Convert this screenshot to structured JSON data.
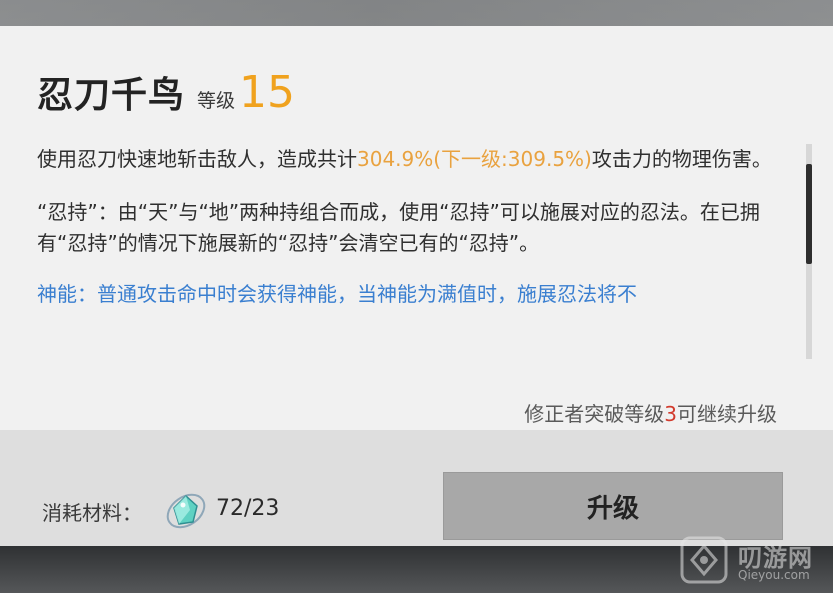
{
  "skill": {
    "name": "忍刀千鸟",
    "level_label": "等级",
    "level_value": "15"
  },
  "description": {
    "p1_prefix": "使用忍刀快速地斩击敌人，造成共计",
    "p1_highlight": "304.9%(下一级:309.5%)",
    "p1_suffix": "攻击力的物理伤害。",
    "p2": "“忍持”：由“天”与“地”两种持组合而成，使用“忍持”可以施展对应的忍法。在已拥有“忍持”的情况下施展新的“忍持”会清空已有的“忍持”。",
    "p3_partial": "神能：普通攻击命中时会获得神能，当神能为满值时，施展忍法将不"
  },
  "upgrade_note": {
    "prefix": "修正者突破等级",
    "level": "3",
    "suffix": "可继续升级"
  },
  "materials": {
    "label": "消耗材料：",
    "icon": "crystal-material-icon",
    "count": "72/23"
  },
  "upgrade_button": {
    "label": "升级"
  },
  "watermark": {
    "text": "叨游网",
    "sub": "Qieyou.com"
  },
  "colors": {
    "accent": "#f0a21e",
    "highlight": "#e9a23f",
    "link_blue": "#3a7fd0",
    "warning_red": "#d23a2c",
    "button_bg": "#a8a8a8"
  }
}
